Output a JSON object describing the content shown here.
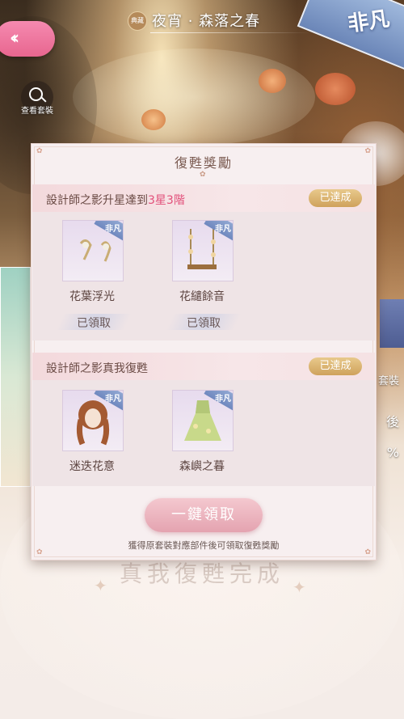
{
  "header": {
    "title_badge": "典藏",
    "title": "夜宵 · 森落之春",
    "rarity": "非凡"
  },
  "view_outfit": {
    "label": "查看套裝"
  },
  "right_fragments": [
    "套裝",
    "後",
    "%"
  ],
  "dialog": {
    "title": "復甦獎勵",
    "sections": [
      {
        "label_prefix": "設計師之影升星達到",
        "label_highlight": "3星3階",
        "status": "已達成",
        "items": [
          {
            "tag": "非凡",
            "name": "花葉浮光",
            "claimed": "已領取"
          },
          {
            "tag": "非凡",
            "name": "花繾餘音",
            "claimed": "已領取"
          }
        ]
      },
      {
        "label_prefix": "設計師之影真我復甦",
        "label_highlight": "",
        "status": "已達成",
        "items": [
          {
            "tag": "非凡",
            "name": "迷迭花意"
          },
          {
            "tag": "非凡",
            "name": "森嶼之暮"
          }
        ]
      }
    ],
    "claim_all": "一鍵領取",
    "hint": "獲得原套裝對應部件後可領取復甦獎勵"
  },
  "background_text": "真我復甦完成",
  "colors": {
    "accent_pink": "#e2507a",
    "badge_gold": "#cfa25c",
    "back_button": "#e8668f"
  }
}
